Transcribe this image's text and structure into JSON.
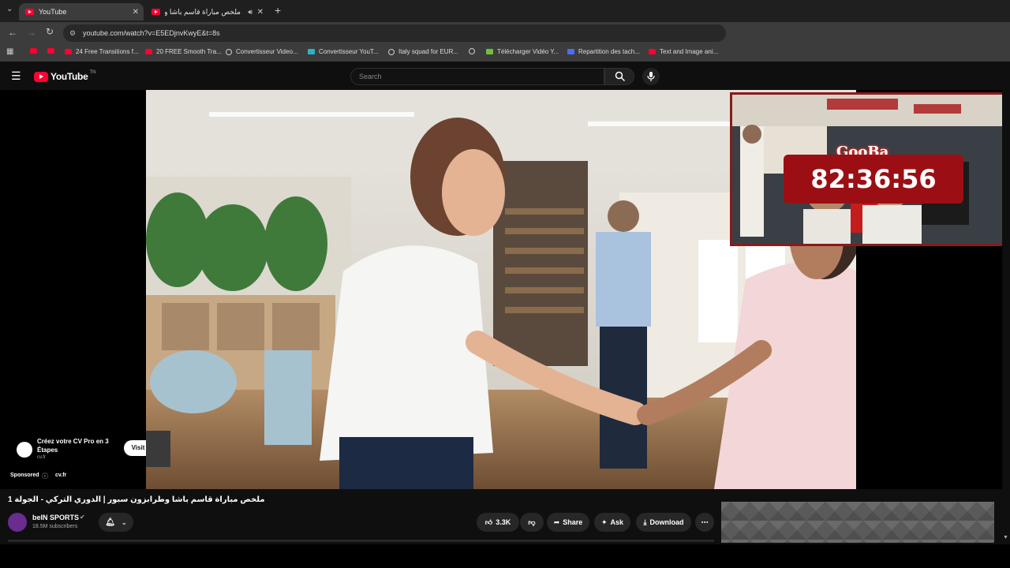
{
  "browser": {
    "tabs": [
      {
        "title": "YouTube"
      },
      {
        "title": "ملخص مباراة قاسم باشا وطر"
      }
    ],
    "url": "youtube.com/watch?v=E5EDjnvKwyE&t=8s",
    "bookmarks": [
      {
        "label": "",
        "icon": "youtube-icon"
      },
      {
        "label": "",
        "icon": "youtube-icon"
      },
      {
        "label": "24 Free Transitions f...",
        "icon": "youtube-icon"
      },
      {
        "label": "20 FREE Smooth Tra...",
        "icon": "youtube-icon"
      },
      {
        "label": "Convertisseur Video...",
        "icon": "globe-icon"
      },
      {
        "label": "Convertisseur YouT...",
        "icon": "converter-icon"
      },
      {
        "label": "Italy squad for EUR...",
        "icon": "globe-icon"
      },
      {
        "label": "",
        "icon": "globe-icon"
      },
      {
        "label": "Télécharger Vidéo Y...",
        "icon": "download-icon"
      },
      {
        "label": "Repartition des tach...",
        "icon": "doc-icon"
      },
      {
        "label": "Text and Image ani...",
        "icon": "youtube-icon"
      }
    ]
  },
  "youtube": {
    "logo_text": "YouTube",
    "logo_region": "TN",
    "search_placeholder": "Search"
  },
  "overlay": {
    "streamer_name": "GooBa",
    "timer": "82:36:56"
  },
  "ad": {
    "title": "Créez votre CV Pro en 3 Étapes",
    "domain": "cv.fr",
    "cta": "Visit site",
    "sponsored_label": "Sponsored",
    "sponsored_domain": "cv.fr"
  },
  "video": {
    "title": "ملخص مباراة قاسم باشا وطرابزون سبور | الدوري التركي - الجولة 1",
    "channel": "beIN SPORTS",
    "subscribers": "18.5M subscribers",
    "likes": "3.3K",
    "share_label": "Share",
    "ask_label": "Ask",
    "download_label": "Download"
  },
  "colors": {
    "brand_red": "#ff0033",
    "timer_bg": "#9b0f14",
    "page_bg": "#0f0f0f"
  }
}
